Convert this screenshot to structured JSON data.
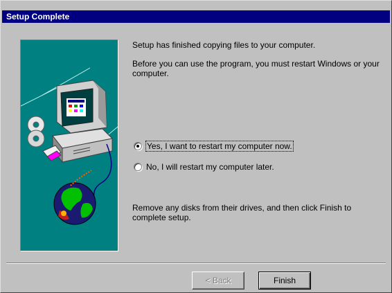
{
  "window": {
    "title": "Setup Complete"
  },
  "body": {
    "line1": "Setup has finished copying files to your computer.",
    "line2": "Before you can use the program, you must restart Windows or your computer.",
    "line3": "Remove any disks from their drives, and then click Finish to complete setup."
  },
  "options": [
    {
      "label": "Yes, I want to restart my computer now.",
      "selected": true
    },
    {
      "label": "No, I will restart my computer later.",
      "selected": false
    }
  ],
  "buttons": {
    "back": "< Back",
    "finish": "Finish"
  },
  "colors": {
    "titlebar": "#000080",
    "panel": "#008080",
    "face": "#c0c0c0"
  },
  "icons": {
    "illustration": "computer-with-discs-and-globe-illustration"
  }
}
